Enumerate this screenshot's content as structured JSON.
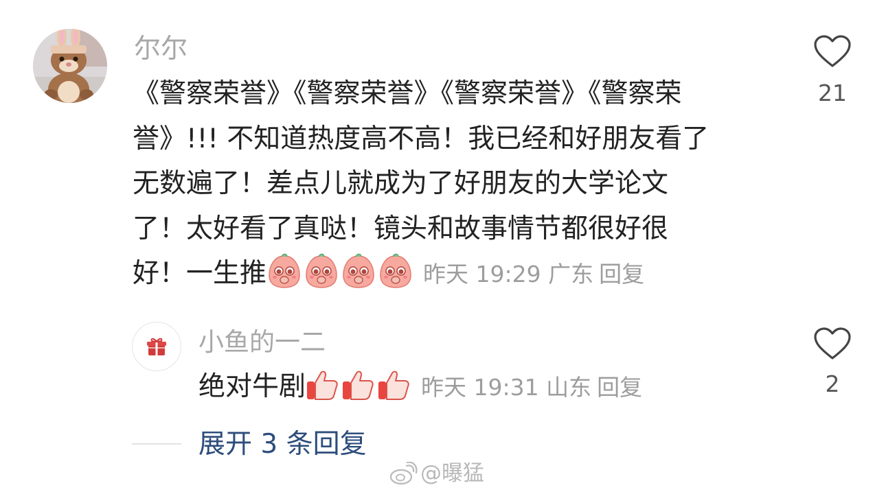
{
  "comment": {
    "username": "尔尔",
    "lines": [
      "《警察荣誉》《警察荣誉》《警察荣誉》《警察荣",
      "誉》!!! 不知道热度高不高！我已经和好朋友看了",
      "无数遍了！差点儿就成为了好朋友的大学论文",
      "了！太好看了真哒！镜头和故事情节都很好很",
      "好！一生推"
    ],
    "emoji": [
      "pleading-face-emoji",
      "pleading-face-emoji",
      "pleading-face-emoji",
      "pleading-face-emoji"
    ],
    "time": "昨天 19:29",
    "location": "广东",
    "reply_label": "回复",
    "likes": "21",
    "like_icon": "heart-outline-icon"
  },
  "reply": {
    "username": "小鱼的一二",
    "avatar_icon": "gift-icon",
    "text": "绝对牛剧",
    "emoji": [
      "thumbs-up-emoji",
      "thumbs-up-emoji",
      "thumbs-up-emoji"
    ],
    "time": "昨天 19:31",
    "location": "山东",
    "reply_label": "回复",
    "likes": "2",
    "like_icon": "heart-outline-icon"
  },
  "expand": {
    "label": "展开 3 条回复"
  },
  "watermark": {
    "text": "@曝猛",
    "icon": "weibo-logo-icon"
  },
  "colors": {
    "username": "#a8a8a8",
    "body_text": "#222222",
    "meta": "#9d9d9d",
    "link": "#2d4d7c",
    "gift_red": "#d23b3b"
  }
}
